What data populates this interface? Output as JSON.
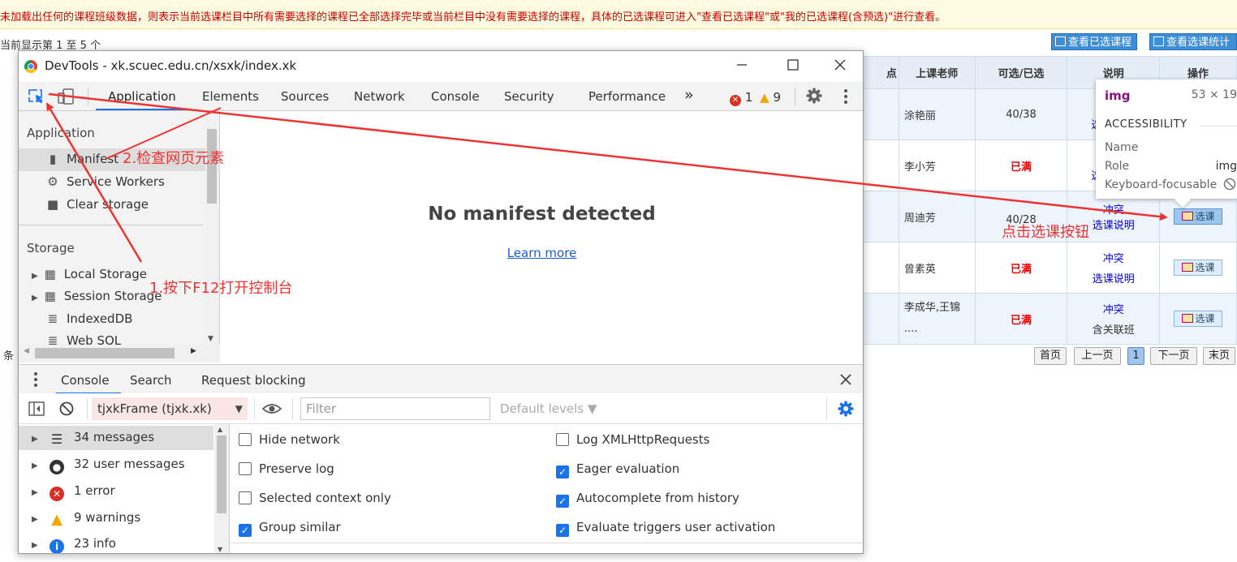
{
  "page": {
    "notice_line1": "未加载出任何的课程班级数据，则表示当前选课栏目中所有需要选择的课程已全部选择完毕或当前栏目中没有需要选择的课程，具体的已选课程可进入\"查看已选课程\"或\"我的已选课程(含预选)\"进行查看。",
    "showing": "当前显示第 1 至 5 个",
    "btn_view_selected": "查看已选课程",
    "btn_view_stats": "查看选课统计",
    "records_label": "条",
    "pager": [
      "首页",
      "上一页",
      "1",
      "下一页",
      "末页"
    ]
  },
  "table": {
    "headers": [
      "点",
      "上课老师",
      "可选/已选",
      "说明",
      "操作"
    ],
    "rows": [
      {
        "teacher": "涂艳丽",
        "quota": "40/38",
        "note1": "",
        "note2": "选",
        "action": ""
      },
      {
        "teacher": "李小芳",
        "quota": "已满",
        "note1": "",
        "note2": "选",
        "action": ""
      },
      {
        "teacher": "周迪芳",
        "quota": "40/28",
        "note1": "冲突",
        "note2": "选课说明",
        "action": "选课"
      },
      {
        "teacher": "曾素英",
        "quota": "已满",
        "note1": "冲突",
        "note2": "选课说明",
        "action": "选课"
      },
      {
        "teacher": "李成华,王锦 ....",
        "quota": "已满",
        "note1": "冲突",
        "note2": "含关联班",
        "action": "选课"
      }
    ]
  },
  "tooltip": {
    "tag": "img",
    "dims": "53 × 19",
    "section": "ACCESSIBILITY",
    "name_label": "Name",
    "role_label": "Role",
    "role_value": "img",
    "keyboard_label": "Keyboard-focusable"
  },
  "devtools": {
    "window_title": "DevTools - xk.scuec.edu.cn/xsxk/index.xk",
    "tabs": [
      "Application",
      "Elements",
      "Sources",
      "Network",
      "Console",
      "Security",
      "Performance"
    ],
    "more": "»",
    "error_count": "1",
    "warning_count": "9",
    "sidebar": {
      "app_section": "Application",
      "app_items": [
        "Manifest",
        "Service Workers",
        "Clear storage"
      ],
      "storage_section": "Storage",
      "storage_items": [
        "Local Storage",
        "Session Storage",
        "IndexedDB",
        "Web SQL"
      ]
    },
    "main": {
      "heading": "No manifest detected",
      "link": "Learn more"
    },
    "drawer_tabs": [
      "Console",
      "Search",
      "Request blocking"
    ],
    "console": {
      "context": "tjxkFrame (tjxk.xk)",
      "filter_placeholder": "Filter",
      "levels": "Default levels ▼",
      "messages": [
        "34 messages",
        "32 user messages",
        "1 error",
        "9 warnings",
        "23 info"
      ],
      "options_left": [
        {
          "label": "Hide network",
          "checked": false
        },
        {
          "label": "Preserve log",
          "checked": false
        },
        {
          "label": "Selected context only",
          "checked": false
        },
        {
          "label": "Group similar",
          "checked": true
        }
      ],
      "options_right": [
        {
          "label": "Log XMLHttpRequests",
          "checked": false
        },
        {
          "label": "Eager evaluation",
          "checked": true
        },
        {
          "label": "Autocomplete from history",
          "checked": true
        },
        {
          "label": "Evaluate triggers user activation",
          "checked": true
        }
      ]
    }
  },
  "annotations": {
    "step1": "1.按下F12打开控制台",
    "step2": "2.检查网页元素",
    "step3": "点击选课按钮"
  },
  "colors": {
    "annotation": "#ee3333",
    "accent": "#1a73e8",
    "full": "#ee0000"
  }
}
